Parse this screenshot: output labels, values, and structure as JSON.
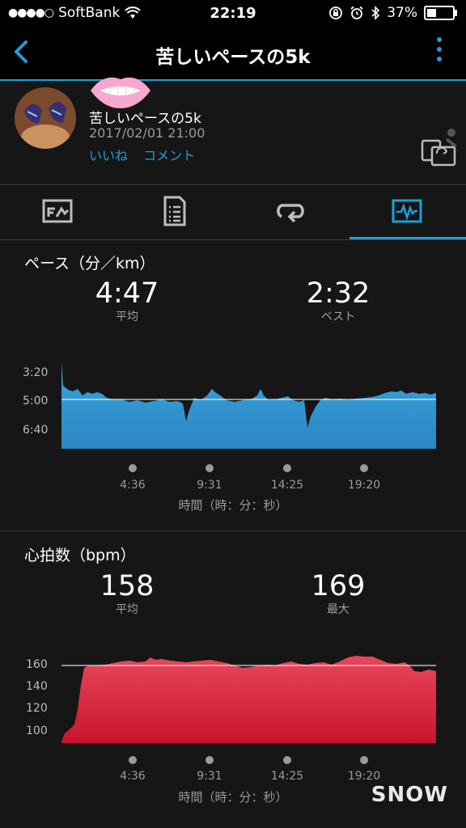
{
  "status_bar": {
    "signal": "●●●●○",
    "carrier": "SoftBank",
    "time": "22:19",
    "battery": "37%",
    "battery_level": 0.37
  },
  "header": {
    "title": "苦しいペースの5k"
  },
  "activity": {
    "name": "苦しいペースの5k",
    "date": "2017/02/01 21:00",
    "like_label": "いいね",
    "comment_label": "コメント"
  },
  "tabs": [
    {
      "icon": "overview-icon"
    },
    {
      "icon": "details-icon"
    },
    {
      "icon": "laps-icon"
    },
    {
      "icon": "charts-icon",
      "active": true
    }
  ],
  "pace": {
    "title": "ペース（分／km）",
    "avg_value": "4:47",
    "avg_label": "平均",
    "best_value": "2:32",
    "best_label": "ベスト",
    "y_ticks": [
      "3:20",
      "5:00",
      "6:40"
    ],
    "x_ticks": [
      "4:36",
      "9:31",
      "14:25",
      "19:20"
    ],
    "x_label": "時間（時：分：秒）",
    "color": "#36a5dc"
  },
  "heart": {
    "title": "心拍数（bpm）",
    "avg_value": "158",
    "avg_label": "平均",
    "max_value": "169",
    "max_label": "最大",
    "y_ticks": [
      "160",
      "140",
      "120",
      "100"
    ],
    "x_ticks": [
      "4:36",
      "9:31",
      "14:25",
      "19:20"
    ],
    "x_label": "時間（時：分：秒）",
    "color": "#e0243a"
  },
  "watermark": "SNOW",
  "colors": {
    "accent": "#1d9fd6",
    "background": "#161616"
  }
}
